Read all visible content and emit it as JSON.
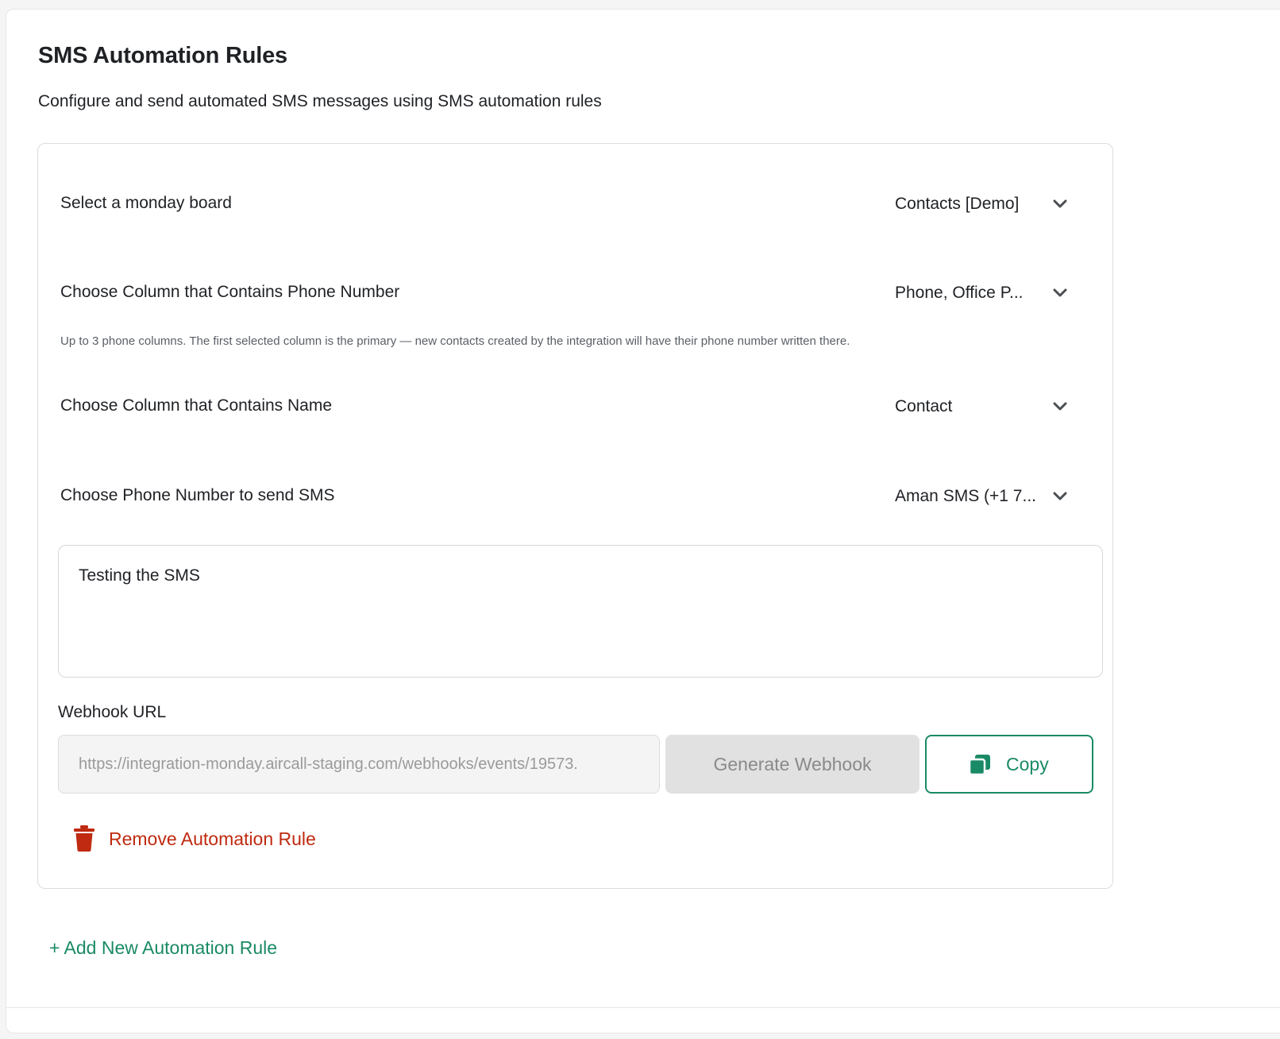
{
  "page": {
    "title": "SMS Automation Rules",
    "subtitle": "Configure and send automated SMS messages using SMS automation rules"
  },
  "rule": {
    "board": {
      "label": "Select a monday board",
      "value": "Contacts [Demo]"
    },
    "phone_column": {
      "label": "Choose Column that Contains Phone Number",
      "value": "Phone, Office P...",
      "helper": "Up to 3 phone columns. The first selected column is the primary — new contacts created by the integration will have their phone number written there."
    },
    "name_column": {
      "label": "Choose Column that Contains Name",
      "value": "Contact"
    },
    "sender_number": {
      "label": "Choose Phone Number to send SMS",
      "value": "Aman SMS (+1 7..."
    },
    "message": "Testing the SMS",
    "webhook": {
      "label": "Webhook URL",
      "url": "https://integration-monday.aircall-staging.com/webhooks/events/19573.",
      "generate_label": "Generate Webhook",
      "copy_label": "Copy"
    },
    "remove_label": "Remove Automation Rule"
  },
  "add_rule_label": "+ Add New Automation Rule",
  "icons": {
    "caret": "chevron-down-icon",
    "copy": "copy-icon",
    "remove": "trash-icon"
  },
  "colors": {
    "accent_green": "#1a8a66",
    "danger_red": "#bf2a10",
    "disabled_gray": "#e1e1e1"
  }
}
